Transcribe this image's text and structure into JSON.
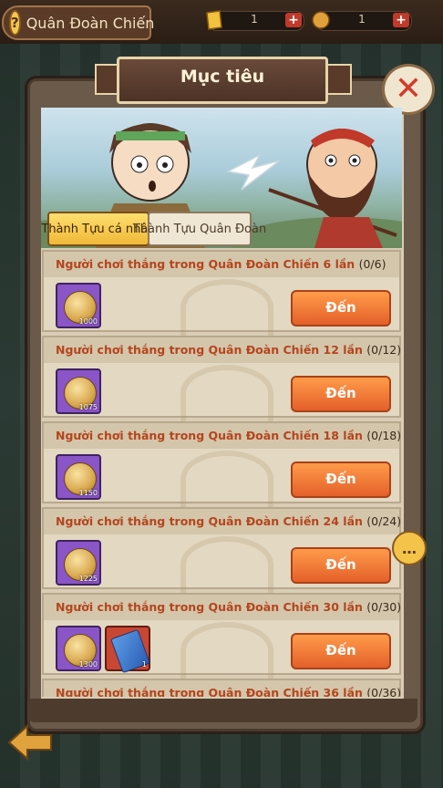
{
  "topbar": {
    "title": "Quân Đoàn Chiến",
    "resource1": {
      "value": "1",
      "icon": "gold-icon"
    },
    "resource2": {
      "value": "1",
      "icon": "medal-icon"
    },
    "plus_label": "+"
  },
  "panel": {
    "title": "Mục tiêu",
    "close_icon": "close-icon"
  },
  "tabs": [
    {
      "label": "Thành Tựu cá nhân",
      "active": true
    },
    {
      "label": "Thành Tựu Quân Đoàn",
      "active": false
    }
  ],
  "items": [
    {
      "title": "Người chơi thắng trong Quân Đoàn Chiến 6 lần",
      "progress": "(0/6)",
      "rewards": [
        {
          "icon": "coin-icon",
          "qty": "1000"
        }
      ],
      "button": "Đến"
    },
    {
      "title": "Người chơi thắng trong Quân Đoàn Chiến 12 lần",
      "progress": "(0/12)",
      "rewards": [
        {
          "icon": "coin-icon",
          "qty": "1075"
        }
      ],
      "button": "Đến"
    },
    {
      "title": "Người chơi thắng trong Quân Đoàn Chiến 18 lần",
      "progress": "(0/18)",
      "rewards": [
        {
          "icon": "coin-icon",
          "qty": "1150"
        }
      ],
      "button": "Đến"
    },
    {
      "title": "Người chơi thắng trong Quân Đoàn Chiến 24 lần",
      "progress": "(0/24)",
      "rewards": [
        {
          "icon": "coin-icon",
          "qty": "1225"
        }
      ],
      "button": "Đến"
    },
    {
      "title": "Người chơi thắng trong Quân Đoàn Chiến 30 lần",
      "progress": "(0/30)",
      "rewards": [
        {
          "icon": "coin-icon",
          "qty": "1300"
        },
        {
          "icon": "scroll-icon",
          "qty": "1"
        }
      ],
      "button": "Đến"
    },
    {
      "title": "Người chơi thắng trong Quân Đoàn Chiến 36 lần",
      "progress": "(0/36)",
      "rewards": [],
      "button": ""
    }
  ],
  "colors": {
    "accent": "#e4602a",
    "title_text": "#b5451d",
    "panel_bg": "#d9cdb5"
  }
}
